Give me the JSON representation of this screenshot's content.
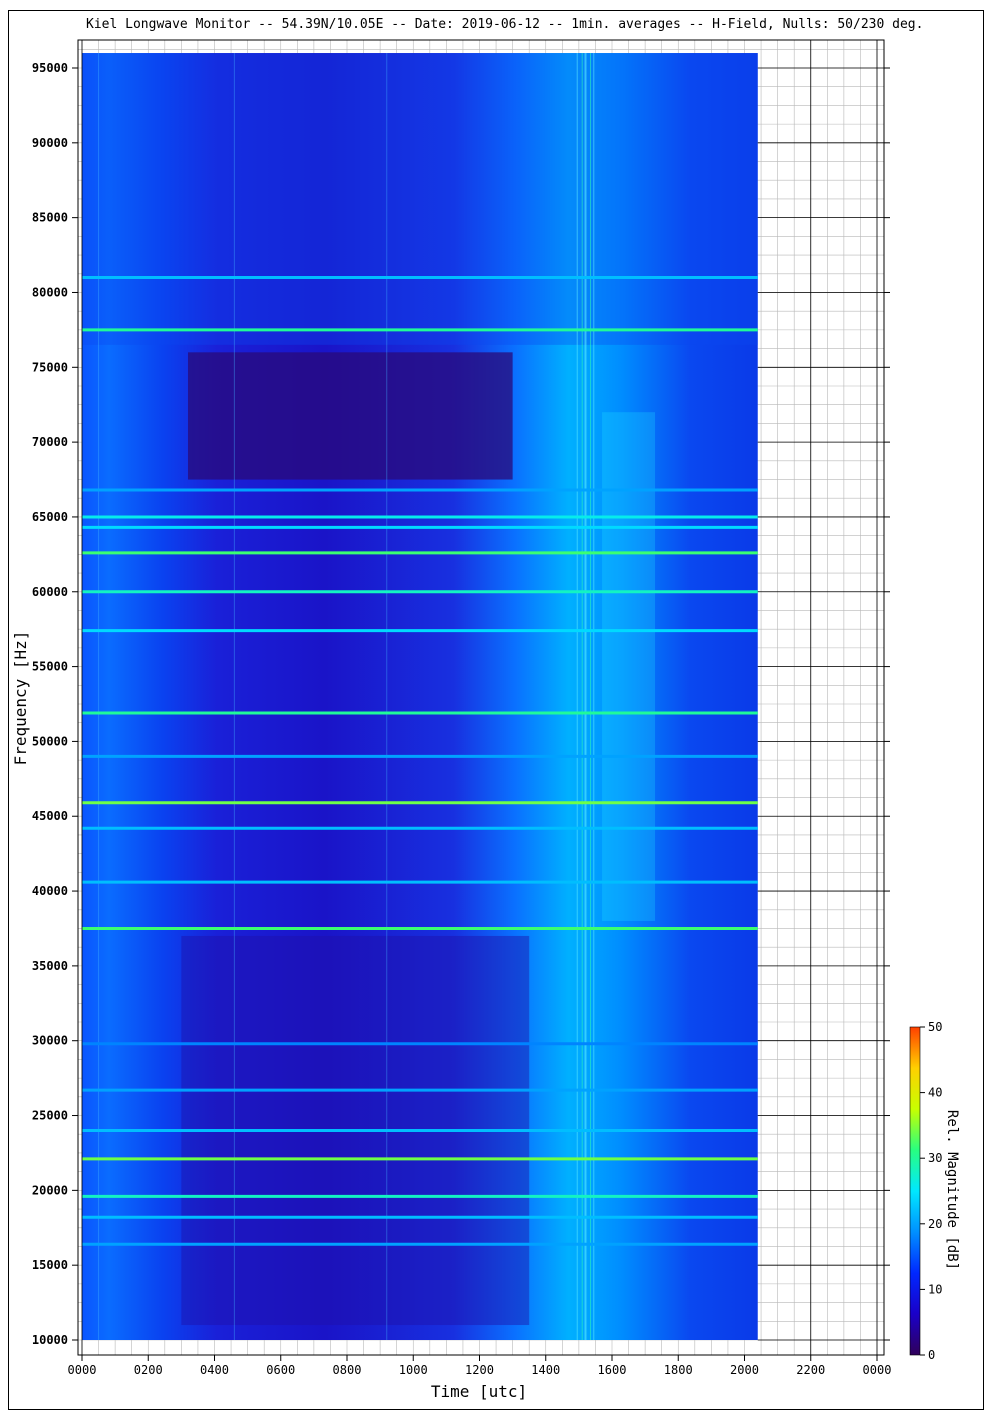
{
  "chart_data": {
    "type": "heatmap",
    "title": "Kiel Longwave Monitor -- 54.39N/10.05E -- Date: 2019-06-12 -- 1min. averages -- H-Field, Nulls: 50/230 deg.",
    "xlabel": "Time [utc]",
    "ylabel": "Frequency [Hz]",
    "colorbar_label": "Rel. Magnitude [dB]",
    "x_ticks": [
      "0000",
      "0200",
      "0400",
      "0600",
      "0800",
      "1000",
      "1200",
      "1400",
      "1600",
      "1800",
      "2000",
      "2200",
      "0000"
    ],
    "x_range_hours": [
      0,
      24
    ],
    "data_end_hours": 20.4,
    "y_ticks": [
      10000,
      15000,
      20000,
      25000,
      30000,
      35000,
      40000,
      45000,
      50000,
      55000,
      60000,
      65000,
      70000,
      75000,
      80000,
      85000,
      90000,
      95000
    ],
    "ylim": [
      9500,
      97000
    ],
    "data_freq_range": [
      10000,
      96000
    ],
    "colorbar_ticks": [
      0,
      10,
      20,
      30,
      40,
      50
    ],
    "colorbar_range": [
      0,
      50
    ],
    "colormap": [
      "#30005a",
      "#1a00c8",
      "#0028ff",
      "#0090ff",
      "#00e8ff",
      "#28ff80",
      "#c8ff00",
      "#ffd000",
      "#ff4000"
    ],
    "grid": true,
    "transmitter_lines": [
      {
        "freq": 81000,
        "db": 22
      },
      {
        "freq": 77500,
        "db": 30
      },
      {
        "freq": 66800,
        "db": 20
      },
      {
        "freq": 65000,
        "db": 26
      },
      {
        "freq": 64300,
        "db": 24
      },
      {
        "freq": 62600,
        "db": 32
      },
      {
        "freq": 60000,
        "db": 28
      },
      {
        "freq": 57400,
        "db": 24
      },
      {
        "freq": 51900,
        "db": 30
      },
      {
        "freq": 49000,
        "db": 20
      },
      {
        "freq": 45900,
        "db": 34
      },
      {
        "freq": 44200,
        "db": 22
      },
      {
        "freq": 40600,
        "db": 22
      },
      {
        "freq": 37500,
        "db": 32
      },
      {
        "freq": 29800,
        "db": 18
      },
      {
        "freq": 26700,
        "db": 20
      },
      {
        "freq": 24000,
        "db": 22
      },
      {
        "freq": 22100,
        "db": 34
      },
      {
        "freq": 19600,
        "db": 28
      },
      {
        "freq": 18200,
        "db": 22
      },
      {
        "freq": 16400,
        "db": 20
      }
    ]
  }
}
